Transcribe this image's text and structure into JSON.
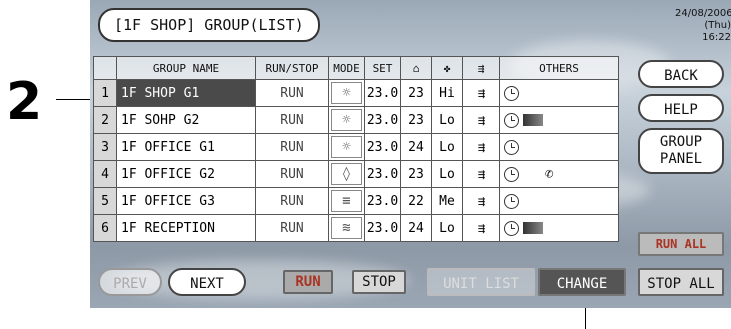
{
  "callout": {
    "number": "2"
  },
  "header": {
    "title": "[1F SHOP] GROUP(LIST)",
    "date": "24/08/2006",
    "day_time": "(Thu) 16:22"
  },
  "columns": {
    "group_name": "GROUP NAME",
    "run_stop": "RUN/STOP",
    "mode": "MODE",
    "set": "SET",
    "others": "OTHERS"
  },
  "rows": [
    {
      "num": "1",
      "name": "1F SHOP G1",
      "run": "RUN",
      "mode_icon": "sun-icon",
      "mode_glyph": "☼",
      "set": "23.0",
      "room": "23",
      "fan": "Hi",
      "others": [
        "timer-icon"
      ]
    },
    {
      "num": "2",
      "name": "1F SOHP G2",
      "run": "RUN",
      "mode_icon": "sun-icon",
      "mode_glyph": "☼",
      "set": "23.0",
      "room": "23",
      "fan": "Lo",
      "others": [
        "timer-icon",
        "filter-icon"
      ]
    },
    {
      "num": "3",
      "name": "1F OFFICE G1",
      "run": "RUN",
      "mode_icon": "sun-icon",
      "mode_glyph": "☼",
      "set": "23.0",
      "room": "24",
      "fan": "Lo",
      "others": [
        "timer-icon"
      ]
    },
    {
      "num": "4",
      "name": "1F OFFICE G2",
      "run": "RUN",
      "mode_icon": "drop-icon",
      "mode_glyph": "◊",
      "set": "23.0",
      "room": "23",
      "fan": "Lo",
      "others": [
        "timer-icon",
        "wrench-icon"
      ]
    },
    {
      "num": "5",
      "name": "1F OFFICE G3",
      "run": "RUN",
      "mode_icon": "fan-mode-icon",
      "mode_glyph": "≡",
      "set": "23.0",
      "room": "22",
      "fan": "Me",
      "others": [
        "timer-icon"
      ]
    },
    {
      "num": "6",
      "name": "1F RECEPTION",
      "run": "RUN",
      "mode_icon": "vent-mode-icon",
      "mode_glyph": "≋",
      "set": "23.0",
      "room": "24",
      "fan": "Lo",
      "others": [
        "timer-icon",
        "filter-icon"
      ]
    }
  ],
  "selected_row": "1",
  "side": {
    "back": "BACK",
    "help": "HELP",
    "group_panel_1": "GROUP",
    "group_panel_2": "PANEL",
    "run_all": "RUN ALL",
    "stop_all": "STOP ALL"
  },
  "bottom": {
    "prev": "PREV",
    "next": "NEXT",
    "run": "RUN",
    "stop": "STOP",
    "unit_list": "UNIT LIST",
    "change": "CHANGE"
  }
}
